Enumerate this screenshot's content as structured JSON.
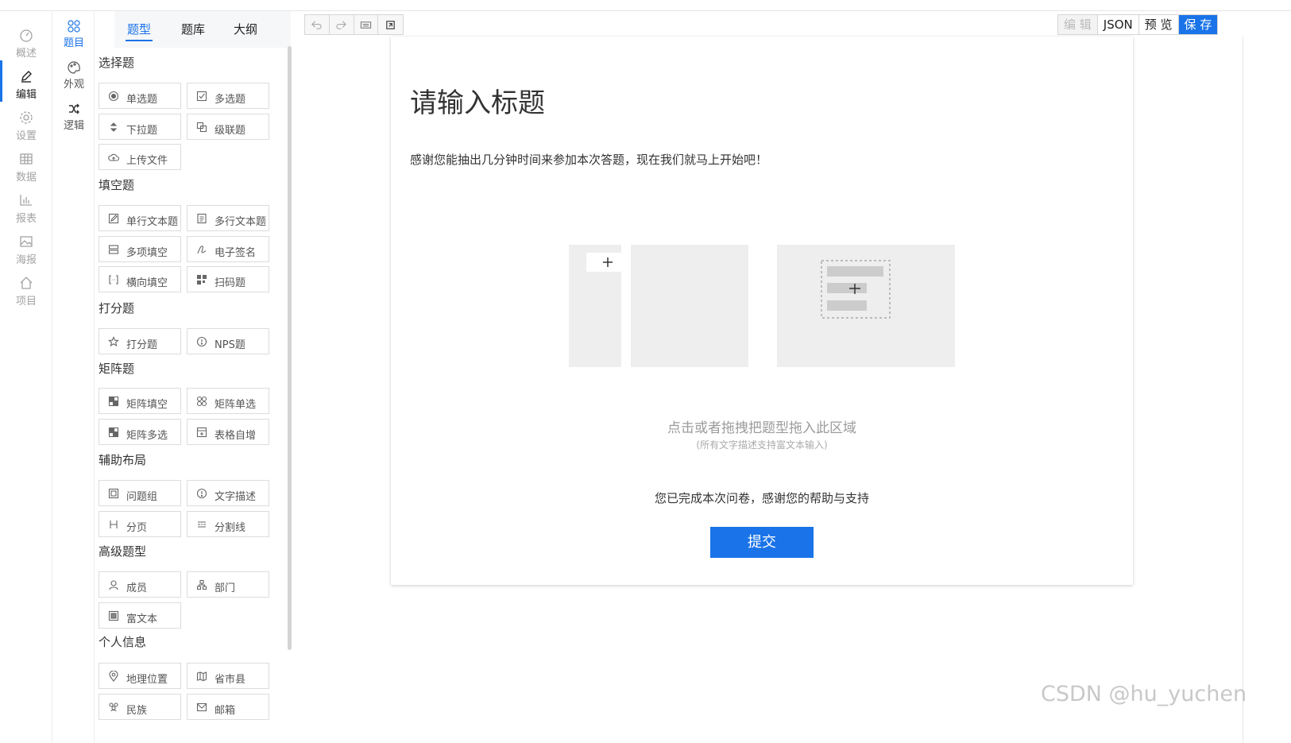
{
  "rail": {
    "items": [
      {
        "label": "概述",
        "icon": "dashboard-icon"
      },
      {
        "label": "编辑",
        "icon": "pen-icon"
      },
      {
        "label": "设置",
        "icon": "gear-icon"
      },
      {
        "label": "数据",
        "icon": "table-icon"
      },
      {
        "label": "报表",
        "icon": "bar-chart-icon"
      },
      {
        "label": "海报",
        "icon": "image-icon"
      },
      {
        "label": "项目",
        "icon": "home-icon"
      }
    ],
    "active": "编辑"
  },
  "rail2": {
    "items": [
      {
        "label": "题目",
        "icon": "four-circles-icon"
      },
      {
        "label": "外观",
        "icon": "palette-icon"
      },
      {
        "label": "逻辑",
        "icon": "shuffle-icon"
      }
    ],
    "active": "题目"
  },
  "panel": {
    "tabs": [
      "题型",
      "题库",
      "大纲"
    ],
    "active_tab": "题型",
    "sections": [
      {
        "title": "选择题",
        "items": [
          "单选题",
          "多选题",
          "下拉题",
          "级联题",
          "上传文件"
        ]
      },
      {
        "title": "填空题",
        "items": [
          "单行文本题",
          "多行文本题",
          "多项填空",
          "电子签名",
          "横向填空",
          "扫码题"
        ]
      },
      {
        "title": "打分题",
        "items": [
          "打分题",
          "NPS题"
        ]
      },
      {
        "title": "矩阵题",
        "items": [
          "矩阵填空",
          "矩阵单选",
          "矩阵多选",
          "表格自增"
        ]
      },
      {
        "title": "辅助布局",
        "items": [
          "问题组",
          "文字描述",
          "分页",
          "分割线"
        ]
      },
      {
        "title": "高级题型",
        "items": [
          "成员",
          "部门",
          "富文本"
        ]
      },
      {
        "title": "个人信息",
        "items": [
          "地理位置",
          "省市县",
          "民族",
          "邮箱"
        ]
      }
    ]
  },
  "toolbar": {
    "left_icons": [
      "undo-icon",
      "redo-icon",
      "keyboard-icon",
      "export-icon"
    ],
    "edit_label": "编 辑",
    "json_label": "JSON",
    "preview_label": "预 览",
    "save_label": "保 存"
  },
  "survey": {
    "title": "请输入标题",
    "description": "感谢您能抽出几分钟时间来参加本次答题，现在我们就马上开始吧！",
    "drop_hint": "点击或者拖拽把题型拖入此区域",
    "drop_subhint": "(所有文字描述支持富文本输入)",
    "finish_text": "您已完成本次问卷，感谢您的帮助与支持",
    "submit_label": "提交"
  },
  "watermark": "CSDN @hu_yuchen"
}
